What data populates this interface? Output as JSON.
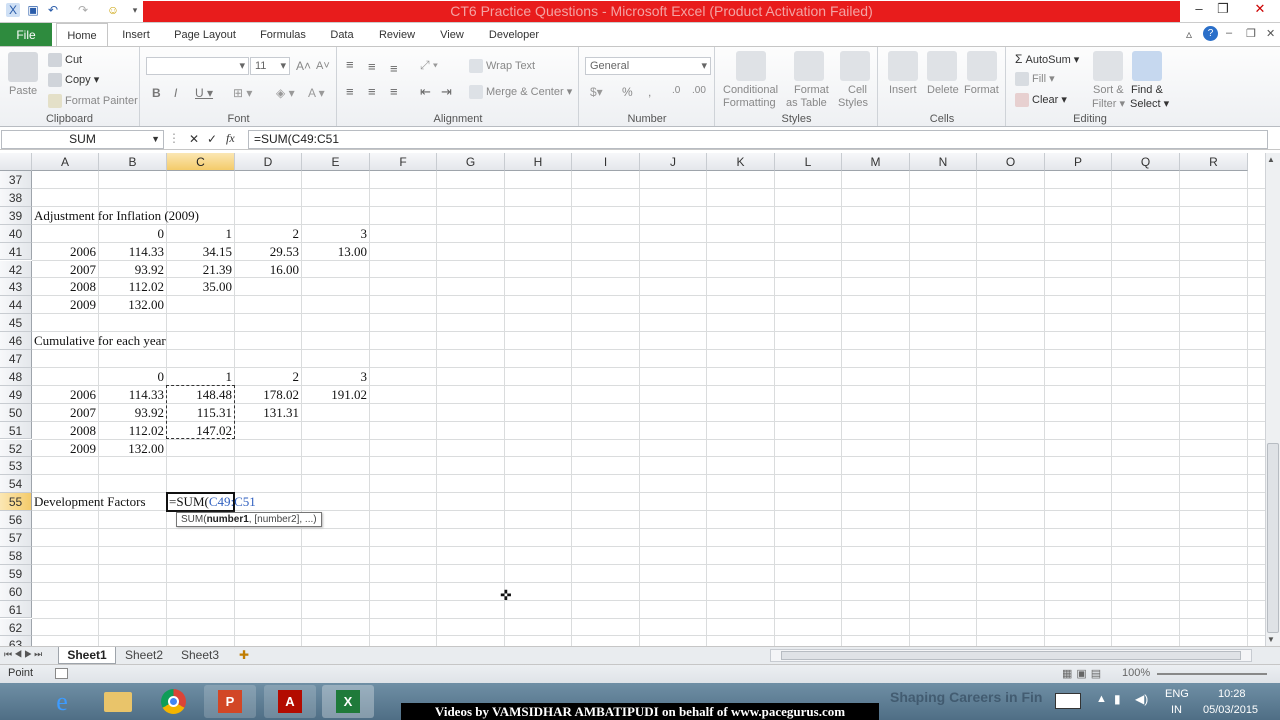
{
  "window": {
    "title": "CT6 Practice Questions - Microsoft Excel (Product Activation Failed)"
  },
  "tabs": {
    "file": "File",
    "home": "Home",
    "insert": "Insert",
    "page_layout": "Page Layout",
    "formulas": "Formulas",
    "data": "Data",
    "review": "Review",
    "view": "View",
    "developer": "Developer"
  },
  "ribbon": {
    "clipboard": {
      "label": "Clipboard",
      "paste": "Paste",
      "cut": "Cut",
      "copy": "Copy",
      "format_painter": "Format Painter"
    },
    "font": {
      "label": "Font",
      "size": "11"
    },
    "alignment": {
      "label": "Alignment",
      "wrap": "Wrap Text",
      "merge": "Merge & Center"
    },
    "number": {
      "label": "Number",
      "format": "General"
    },
    "styles": {
      "label": "Styles",
      "cond1": "Conditional",
      "cond2": "Formatting",
      "fmt1": "Format",
      "fmt2": "as Table",
      "cell1": "Cell",
      "cell2": "Styles"
    },
    "cells": {
      "label": "Cells",
      "insert": "Insert",
      "delete": "Delete",
      "format": "Format"
    },
    "editing": {
      "label": "Editing",
      "autosum": "AutoSum",
      "fill": "Fill",
      "clear": "Clear",
      "sort1": "Sort &",
      "sort2": "Filter",
      "find1": "Find &",
      "find2": "Select"
    }
  },
  "formula_bar": {
    "name_box": "SUM",
    "formula": "=SUM(C49:C51"
  },
  "columns": [
    "A",
    "B",
    "C",
    "D",
    "E",
    "F",
    "G",
    "H",
    "I",
    "J",
    "K",
    "L",
    "M",
    "N",
    "O",
    "P",
    "Q",
    "R"
  ],
  "rows": [
    "37",
    "38",
    "39",
    "40",
    "41",
    "42",
    "43",
    "44",
    "45",
    "46",
    "47",
    "48",
    "49",
    "50",
    "51",
    "52",
    "53",
    "54",
    "55",
    "56",
    "57",
    "58",
    "59",
    "60",
    "61",
    "62",
    "63"
  ],
  "cells": {
    "a39": "Adjustment for Inflation (2009)",
    "b40": "0",
    "c40": "1",
    "d40": "2",
    "e40": "3",
    "a41": "2006",
    "b41": "114.33",
    "c41": "34.15",
    "d41": "29.53",
    "e41": "13.00",
    "a42": "2007",
    "b42": "93.92",
    "c42": "21.39",
    "d42": "16.00",
    "a43": "2008",
    "b43": "112.02",
    "c43": "35.00",
    "a44": "2009",
    "b44": "132.00",
    "a46": "Cumulative for each year",
    "b48": "0",
    "c48": "1",
    "d48": "2",
    "e48": "3",
    "a49": "2006",
    "b49": "114.33",
    "c49": "148.48",
    "d49": "178.02",
    "e49": "191.02",
    "a50": "2007",
    "b50": "93.92",
    "c50": "115.31",
    "d50": "131.31",
    "a51": "2008",
    "b51": "112.02",
    "c51": "147.02",
    "a52": "2009",
    "b52": "132.00",
    "a55": "Development Factors",
    "c55_prefix": "=SUM(",
    "c55_ref": "C49:C51"
  },
  "tooltip": {
    "fn": "SUM(",
    "arg1": "number1",
    "rest": ", [number2], ...)"
  },
  "sheets": [
    "Sheet1",
    "Sheet2",
    "Sheet3"
  ],
  "status": {
    "mode": "Point",
    "zoom": "100%"
  },
  "taskbar": {
    "lang1": "ENG",
    "lang2": "IN",
    "time": "10:28",
    "date": "05/03/2015",
    "watermark": "Shaping Careers in Fin",
    "banner": "Videos by VAMSIDHAR AMBATIPUDI on behalf of www.pacegurus.com"
  }
}
